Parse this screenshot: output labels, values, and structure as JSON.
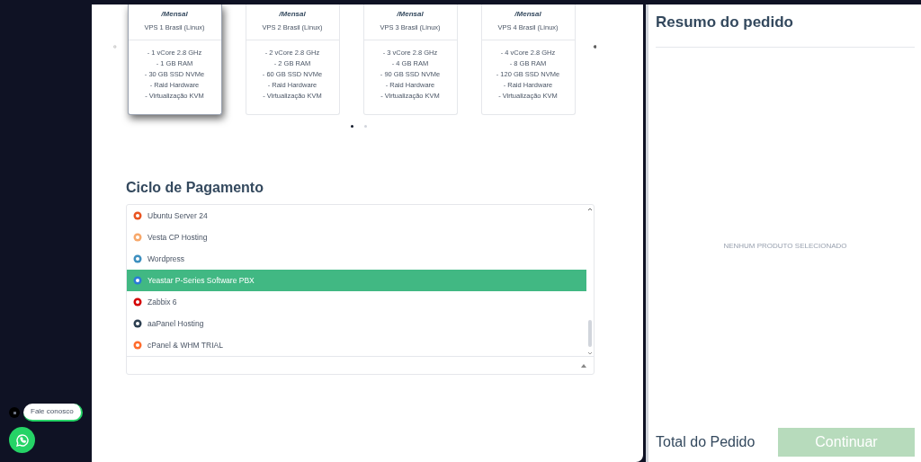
{
  "plans": [
    {
      "period": "/Mensal",
      "name": "VPS 1 Brasil (Linux)",
      "features": [
        "- 1 vCore 2.8 GHz",
        "- 1 GB RAM",
        "- 30 GB SSD NVMe",
        "- Raid Hardware",
        "- Virtualização KVM"
      ],
      "selected": true
    },
    {
      "period": "/Mensal",
      "name": "VPS 2 Brasil (Linux)",
      "features": [
        "- 2 vCore 2.8 GHz",
        "- 2 GB RAM",
        "- 60 GB SSD NVMe",
        "- Raid Hardware",
        "- Virtualização KVM"
      ],
      "selected": false
    },
    {
      "period": "/Mensal",
      "name": "VPS 3 Brasil (Linux)",
      "features": [
        "- 3 vCore 2.8 GHz",
        "- 4 GB RAM",
        "- 90 GB SSD NVMe",
        "- Raid Hardware",
        "- Virtualização KVM"
      ],
      "selected": false
    },
    {
      "period": "/Mensal",
      "name": "VPS 4 Brasil (Linux)",
      "features": [
        "- 4 vCore 2.8 GHz",
        "- 8 GB RAM",
        "- 120 GB SSD NVMe",
        "- Raid Hardware",
        "- Virtualização KVM"
      ],
      "selected": false
    }
  ],
  "carousel_dots": [
    {
      "selected": true
    },
    {
      "selected": false
    }
  ],
  "payment_cycle": {
    "title": "Ciclo de Pagamento",
    "options": [
      {
        "label": "Ubuntu Server 24",
        "color": "#e95420",
        "selected": false
      },
      {
        "label": "Vesta CP Hosting",
        "color": "#f7a86b",
        "selected": false
      },
      {
        "label": "Wordpress",
        "color": "#3d8fbf",
        "selected": false
      },
      {
        "label": "Yeastar P-Series Software PBX",
        "color": "#2a7bd6",
        "selected": true
      },
      {
        "label": "Zabbix 6",
        "color": "#d40000",
        "selected": false
      },
      {
        "label": "aaPanel Hosting",
        "color": "#2c3e50",
        "selected": false
      },
      {
        "label": "cPanel & WHM TRIAL",
        "color": "#ff6c2c",
        "selected": false
      }
    ]
  },
  "summary": {
    "title": "Resumo do pedido",
    "empty_text": "NENHUM PRODUTO SELECIONADO",
    "total_label": "Total do Pedido",
    "continue_button": "Continuar"
  },
  "chat": {
    "bubble": "Fale conosco"
  }
}
